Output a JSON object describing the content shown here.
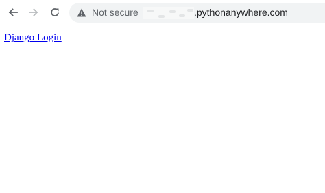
{
  "toolbar": {
    "security_label": "Not secure",
    "url_domain": ".pythonanywhere.com",
    "icons": [
      "back-arrow-icon",
      "forward-arrow-icon",
      "reload-icon",
      "warning-triangle-icon"
    ]
  },
  "page": {
    "link_text": "Django Login"
  },
  "colors": {
    "link": "#0000ee",
    "omnibox_bg": "#f1f3f4",
    "icon_active": "#5f6368",
    "icon_disabled": "#b8bbbe"
  }
}
